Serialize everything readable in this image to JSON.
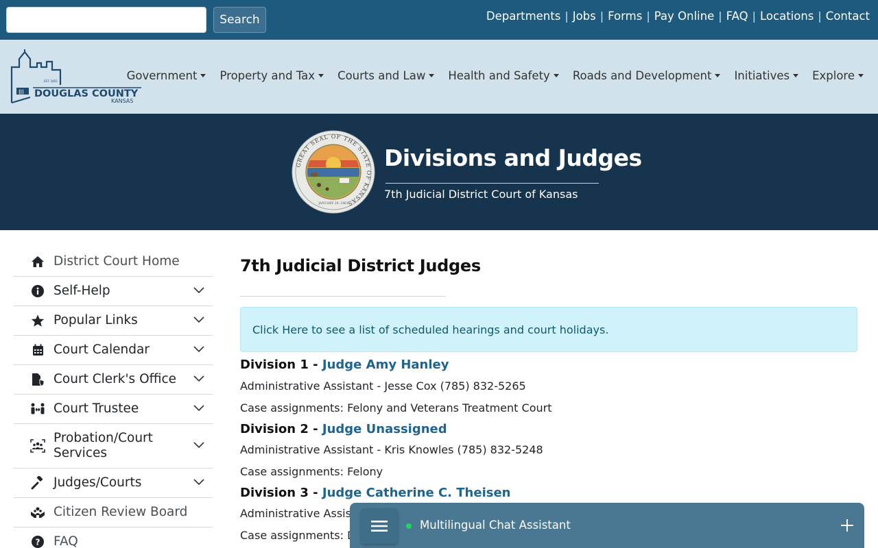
{
  "search": {
    "placeholder": "",
    "button_label": "Search"
  },
  "utility_nav": [
    "Departments",
    "Jobs",
    "Forms",
    "Pay Online",
    "FAQ",
    "Locations",
    "Contact"
  ],
  "logo": {
    "name": "DOUGLAS COUNTY",
    "state": "KANSAS",
    "est": "EST. 1855"
  },
  "main_nav": [
    "Government",
    "Property and Tax",
    "Courts and Law",
    "Health and Safety",
    "Roads and Development",
    "Initiatives",
    "Explore"
  ],
  "hero": {
    "title": "Divisions and Judges",
    "subtitle": "7th Judicial District Court of Kansas",
    "seal_text": "GREAT SEAL OF THE STATE OF KANSAS",
    "seal_date": "JANUARY 29, 1861"
  },
  "sidebar": {
    "items": [
      {
        "label": "District Court Home",
        "icon": "home-icon"
      },
      {
        "label": "Self-Help",
        "icon": "info-circle-icon"
      },
      {
        "label": "Popular Links",
        "icon": "star-icon"
      },
      {
        "label": "Court Calendar",
        "icon": "calendar-icon"
      },
      {
        "label": "Court Clerk's Office",
        "icon": "file-shield-icon"
      },
      {
        "label": "Court Trustee",
        "icon": "people-arrows-icon"
      },
      {
        "label": "Probation/Court",
        "label2": "Services",
        "icon": "group-frame-icon"
      },
      {
        "label": "Judges/Courts",
        "icon": "gavel-icon"
      },
      {
        "label": "Citizen Review Board",
        "icon": "hands-people-icon"
      },
      {
        "label": "FAQ",
        "icon": "question-circle-icon"
      }
    ]
  },
  "main": {
    "heading": "7th Judicial District Judges",
    "alert_link": "Click Here",
    "alert_text": "to see a list of scheduled hearings and court holidays.",
    "divisions": [
      {
        "division": "Division 1 -",
        "judge": "Judge Amy Hanley",
        "assistant": "Administrative Assistant - Jesse Cox (785) 832-5265",
        "cases": "Case assignments: Felony and Veterans Treatment Court"
      },
      {
        "division": "Division 2 -",
        "judge": "Judge Unassigned",
        "assistant": "Administrative Assistant - Kris Knowles (785) 832-5248",
        "cases": "Case assignments: Felony"
      },
      {
        "division": "Division 3 -",
        "judge": "Judge Catherine C. Theisen",
        "assistant": "Administrative Assista",
        "cases": "Case assignments:  D"
      }
    ]
  },
  "chat": {
    "label": "Multilingual Chat Assistant",
    "status_color": "#1ed760"
  },
  "colors": {
    "topbar": "#1d5a7d",
    "mainbar": "#d2e2ec",
    "hero": "#17344f",
    "link": "#1e6490",
    "alert_bg": "#cff2fb",
    "chat": "#4a7893"
  }
}
